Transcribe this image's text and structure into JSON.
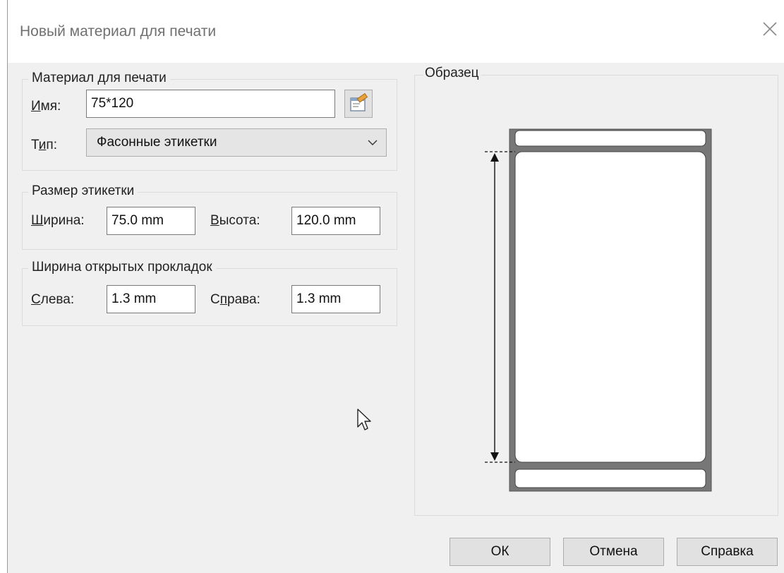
{
  "window": {
    "title": "Новый материал для печати"
  },
  "material": {
    "group_title": "Материал для печати",
    "name_label_u": "И",
    "name_label_rest": "мя:",
    "name_value": "75*120",
    "type_label_a": "Т",
    "type_label_u": "и",
    "type_label_b": "п:",
    "type_value": "Фасонные этикетки"
  },
  "label_size": {
    "group_title": "Размер этикетки",
    "width_label_u": "Ш",
    "width_label_rest": "ирина:",
    "width_value": "75.0 mm",
    "height_label_u": "В",
    "height_label_rest": "ысота:",
    "height_value": "120.0 mm"
  },
  "liner": {
    "group_title": "Ширина открытых прокладок",
    "left_label_u": "С",
    "left_label_rest": "лева:",
    "left_value": "1.3 mm",
    "right_label_a": "С",
    "right_label_u": "п",
    "right_label_b": "рава:",
    "right_value": "1.3 mm"
  },
  "preview": {
    "title": "Образец"
  },
  "buttons": {
    "ok": "ОК",
    "cancel": "Отмена",
    "help": "Справка"
  },
  "icons": {
    "close": "close-icon",
    "properties": "properties-icon",
    "dropdown": "chevron-down-icon",
    "cursor": "mouse-cursor-icon"
  }
}
